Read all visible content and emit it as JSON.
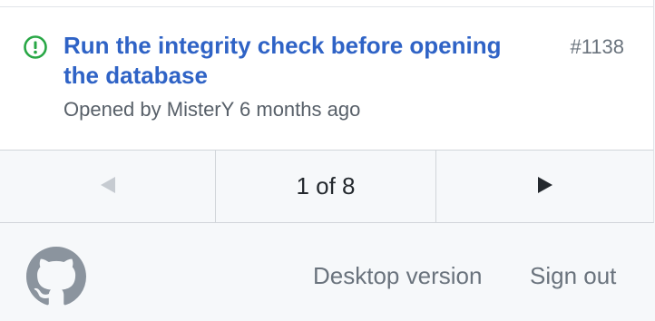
{
  "issue": {
    "title": "Run the integrity check before opening the database",
    "number": "#1138",
    "meta": "Opened by MisterY 6 months ago",
    "icon": "issue-opened-icon",
    "state_color": "#28a745"
  },
  "pagination": {
    "status": "1 of 8",
    "prev_icon": "triangle-left-icon",
    "next_icon": "triangle-right-icon"
  },
  "footer": {
    "logo": "github-logo-icon",
    "desktop_version": "Desktop version",
    "sign_out": "Sign out"
  }
}
